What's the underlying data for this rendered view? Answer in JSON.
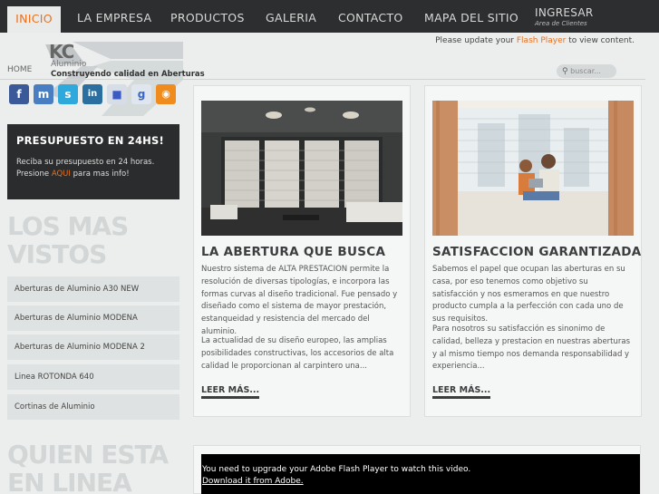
{
  "nav": {
    "items": [
      {
        "label": "INICIO",
        "active": true
      },
      {
        "label": "LA EMPRESA"
      },
      {
        "label": "PRODUCTOS"
      },
      {
        "label": "GALERIA"
      },
      {
        "label": "CONTACTO"
      },
      {
        "label": "MAPA DEL SITIO"
      }
    ],
    "login_label": "INGRESAR",
    "login_sub": "Area de Clientes"
  },
  "header": {
    "flash_pre": "Please update your ",
    "flash_link": "Flash Player",
    "flash_post": " to view content.",
    "logo_text": "KC",
    "logo_sub": "Aluminio",
    "tagline": "Construyendo calidad en Aberturas",
    "breadcrumb": "HOME",
    "search_placeholder": "buscar..."
  },
  "social": [
    {
      "icon": "facebook-icon",
      "glyph": "f",
      "color": "#3b5998"
    },
    {
      "icon": "messenger-icon",
      "glyph": "m",
      "color": "#4a7ec2"
    },
    {
      "icon": "skype-icon",
      "glyph": "s",
      "color": "#2fa9dc"
    },
    {
      "icon": "linkedin-icon",
      "glyph": "in",
      "color": "#2a6fa0"
    },
    {
      "icon": "delicious-icon",
      "glyph": "■",
      "color": "#d7dde6"
    },
    {
      "icon": "google-icon",
      "glyph": "g",
      "color": "#dfe6f0"
    },
    {
      "icon": "rss-icon",
      "glyph": "◉",
      "color": "#f08c1e"
    }
  ],
  "presupuesto": {
    "title": "PRESUPUESTO EN 24HS!",
    "line1": "Reciba su presupuesto en 24 horas.",
    "line2_pre": "Presione ",
    "line2_link": "AQUI",
    "line2_post": " para mas info!"
  },
  "mas_vistos": {
    "title_line1": "LOS MAS",
    "title_line2": "VISTOS",
    "items": [
      "Aberturas de Aluminio A30 NEW",
      "Aberturas de Aluminio MODENA",
      "Aberturas de Aluminio MODENA 2",
      "Linea ROTONDA 640",
      "Cortinas de Aluminio"
    ]
  },
  "quien": {
    "title_line1": "QUIEN ESTA",
    "title_line2": "EN LINEA"
  },
  "cards": [
    {
      "title": "LA ABERTURA QUE BUSCA",
      "para1": "Nuestro sistema de ALTA PRESTACION permite la resolución de diversas tipologías, e incorpora las formas curvas al diseño tradicional. Fue pensado y diseñado como el sistema de mayor prestación, estanqueidad y resistencia del mercado del aluminio.",
      "para2": "La actualidad de su diseño europeo, las amplias posibilidades constructivas, los accesorios de alta calidad le proporcionan al carpintero una...",
      "more": "LEER MÁS..."
    },
    {
      "title": "SATISFACCION GARANTIZADA",
      "para1": "Sabemos el papel que ocupan las aberturas en su casa, por eso tenemos como objetivo su satisfacción y nos esmeramos en que nuestro producto cumpla a la perfección con cada uno de sus requisitos.",
      "para2": "Para nosotros su satisfacción es sinonimo de calidad, belleza y prestacion en nuestras aberturas y al mismo tiempo nos demanda responsabilidad y experiencia...",
      "more": "LEER MÁS..."
    }
  ],
  "video": {
    "message": "You need to upgrade your Adobe Flash Player to watch this video.",
    "download": "Download it from Adobe."
  },
  "colors": {
    "accent": "#e8701e",
    "nav_bg": "#2c2e2f",
    "page_bg": "#eceeee"
  }
}
